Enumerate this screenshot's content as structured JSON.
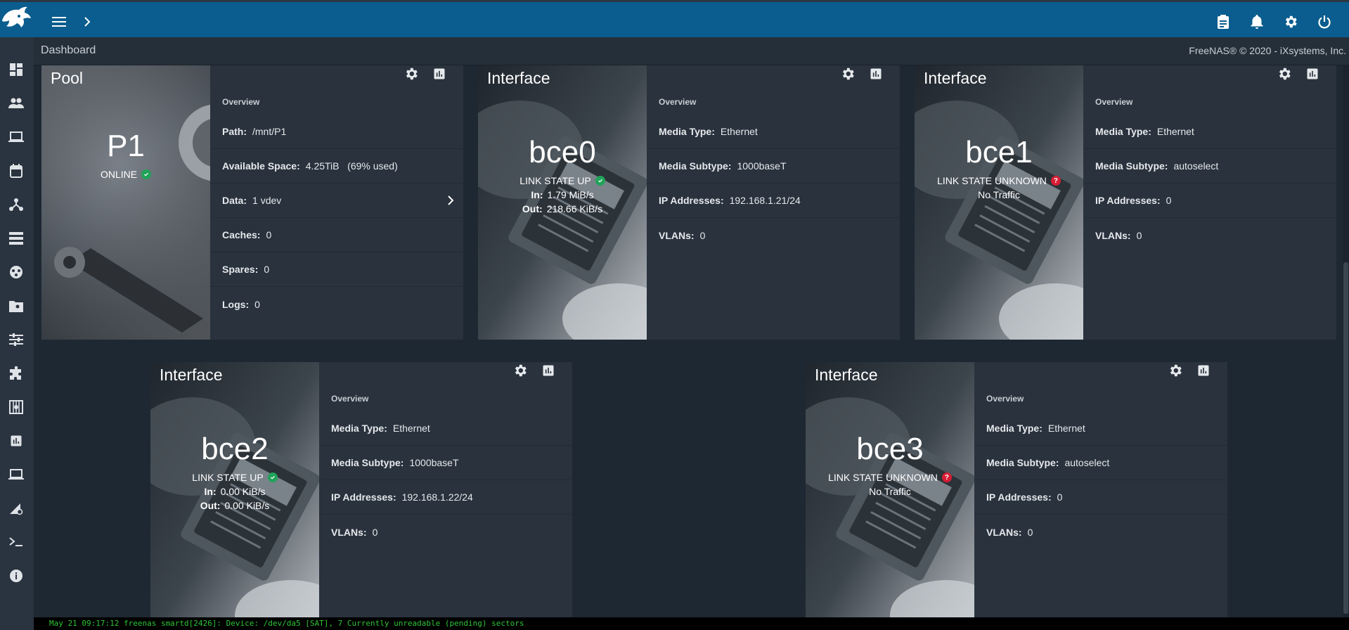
{
  "colors": {
    "topbar": "#0a5d8e",
    "ok": "#21a35a",
    "error": "#d71d34",
    "log_text": "#2ec436"
  },
  "topbar": {
    "menu_icon": "menu-icon",
    "chevron_icon": "chevron-right-icon",
    "right_icons": [
      "clipboard-icon",
      "bell-icon",
      "gear-icon",
      "power-icon"
    ]
  },
  "sidebar": {
    "icons": [
      "dashboard-icon",
      "accounts-icon",
      "system-icon",
      "tasks-icon",
      "network-icon",
      "storage-icon",
      "directory-services-icon",
      "sharing-icon",
      "services-icon",
      "plugins-icon",
      "jails-icon",
      "reporting-icon",
      "virtual-machines-icon",
      "display-settings-icon",
      "shell-icon",
      "guide-icon"
    ]
  },
  "breadcrumb": "Dashboard",
  "copyright": "FreeNAS® © 2020 - iXsystems, Inc.",
  "cards": {
    "pool": {
      "title": "Pool",
      "name": "P1",
      "status": "ONLINE",
      "overview": "Overview",
      "rows": [
        {
          "label": "Path:",
          "value": "/mnt/P1"
        },
        {
          "label": "Available Space:",
          "value": "4.25TiB   (69% used)"
        },
        {
          "label": "Data:",
          "value": "1 vdev"
        },
        {
          "label": "Caches:",
          "value": "0"
        },
        {
          "label": "Spares:",
          "value": "0"
        },
        {
          "label": "Logs:",
          "value": "0"
        }
      ]
    },
    "bce0": {
      "title": "Interface",
      "name": "bce0",
      "status": "LINK STATE UP",
      "in_label": "In:",
      "in_value": "1.79 MiB/s",
      "out_label": "Out:",
      "out_value": "218.66 KiB/s",
      "overview": "Overview",
      "rows": [
        {
          "label": "Media Type:",
          "value": "Ethernet"
        },
        {
          "label": "Media Subtype:",
          "value": "1000baseT"
        },
        {
          "label": "IP Addresses:",
          "value": "192.168.1.21/24"
        },
        {
          "label": "VLANs:",
          "value": "0"
        }
      ]
    },
    "bce1": {
      "title": "Interface",
      "name": "bce1",
      "status": "LINK STATE UNKNOWN",
      "traffic": "No Traffic",
      "overview": "Overview",
      "rows": [
        {
          "label": "Media Type:",
          "value": "Ethernet"
        },
        {
          "label": "Media Subtype:",
          "value": "autoselect"
        },
        {
          "label": "IP Addresses:",
          "value": "0"
        },
        {
          "label": "VLANs:",
          "value": "0"
        }
      ]
    },
    "bce2": {
      "title": "Interface",
      "name": "bce2",
      "status": "LINK STATE UP",
      "in_label": "In:",
      "in_value": "0.00 KiB/s",
      "out_label": "Out:",
      "out_value": "0.00 KiB/s",
      "overview": "Overview",
      "rows": [
        {
          "label": "Media Type:",
          "value": "Ethernet"
        },
        {
          "label": "Media Subtype:",
          "value": "1000baseT"
        },
        {
          "label": "IP Addresses:",
          "value": "192.168.1.22/24"
        },
        {
          "label": "VLANs:",
          "value": "0"
        }
      ]
    },
    "bce3": {
      "title": "Interface",
      "name": "bce3",
      "status": "LINK STATE UNKNOWN",
      "traffic": "No Traffic",
      "overview": "Overview",
      "rows": [
        {
          "label": "Media Type:",
          "value": "Ethernet"
        },
        {
          "label": "Media Subtype:",
          "value": "autoselect"
        },
        {
          "label": "IP Addresses:",
          "value": "0"
        },
        {
          "label": "VLANs:",
          "value": "0"
        }
      ]
    }
  },
  "log": "May 21 09:17:12 freenas smartd[2426]: Device: /dev/da5 [SAT], 7 Currently unreadable (pending) sectors"
}
